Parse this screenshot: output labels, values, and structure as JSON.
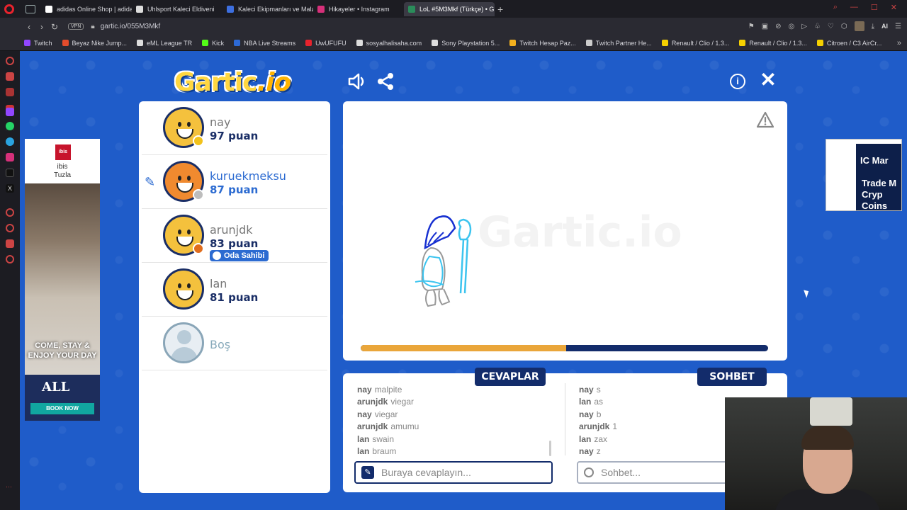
{
  "browser": {
    "tabs": [
      {
        "title": "adidas Online Shop | adidas",
        "color": "#ffffff"
      },
      {
        "title": "Uhlsport Kaleci Eldiveni",
        "color": "#dddddd"
      },
      {
        "title": "Kaleci Ekipmanları ve Malz",
        "color": "#3d6fe0"
      },
      {
        "title": "Hikayeler • Instagram",
        "color": "#d6307a"
      },
      {
        "title": "LoL #5M3Mkf (Türkçe) • G",
        "color": "#2a8c5a",
        "active": true
      }
    ],
    "new_tab": "+",
    "url": "gartic.io/055M3Mkf",
    "vpn_label": "VPN",
    "ai_label": "AI",
    "bookmarks": [
      {
        "label": "Twitch",
        "color": "#9146ff"
      },
      {
        "label": "Beyaz Nike Jump...",
        "color": "#e34c2c"
      },
      {
        "label": "eML League TR",
        "color": "#dddddd"
      },
      {
        "label": "Kick",
        "color": "#53fc18"
      },
      {
        "label": "NBA Live Streams",
        "color": "#2d6ad6"
      },
      {
        "label": "UwUFUFU",
        "color": "#e8232d"
      },
      {
        "label": "sosyalhalisaha.com",
        "color": "#dddddd"
      },
      {
        "label": "Sony Playstation 5...",
        "color": "#dddddd"
      },
      {
        "label": "Twitch Hesap Paz...",
        "color": "#f2b01e"
      },
      {
        "label": "Twitch Partner He...",
        "color": "#cccccc"
      },
      {
        "label": "Renault / Clio / 1.3...",
        "color": "#f5d000"
      },
      {
        "label": "Renault / Clio / 1.3...",
        "color": "#f5d000"
      },
      {
        "label": "Citroen / C3 AirCr...",
        "color": "#f5d000"
      }
    ]
  },
  "game": {
    "logo_main": "Gartic",
    "logo_suffix": ".io",
    "players": [
      {
        "name": "nay",
        "score": "97 puan",
        "avatar_color": "#f4c13d",
        "dot_color": "#f2c21b"
      },
      {
        "name": "kuruekmeksu",
        "score": "87 puan",
        "avatar_color": "#f08a2f",
        "dot_color": "#bdbdbd",
        "drawing": true
      },
      {
        "name": "arunjdk",
        "score": "83 puan",
        "avatar_color": "#f4c13d",
        "dot_color": "#e06d1d",
        "badge": "Oda Sahibi"
      },
      {
        "name": "lan",
        "score": "81 puan",
        "avatar_color": "#f4c13d"
      },
      {
        "name": "Boş",
        "empty": true
      }
    ],
    "watermark": "Gartic.io",
    "progress_fraction": 0.505,
    "answers_label": "CEVAPLAR",
    "chat_label": "SOHBET",
    "answers": [
      {
        "who": "nay",
        "text": "malpite"
      },
      {
        "who": "arunjdk",
        "text": "viegar"
      },
      {
        "who": "nay",
        "text": "viegar"
      },
      {
        "who": "arunjdk",
        "text": "amumu"
      },
      {
        "who": "lan",
        "text": "swain"
      },
      {
        "who": "lan",
        "text": "braum"
      }
    ],
    "chat": [
      {
        "who": "nay",
        "text": "s"
      },
      {
        "who": "lan",
        "text": "as"
      },
      {
        "who": "nay",
        "text": "b"
      },
      {
        "who": "arunjdk",
        "text": "1"
      },
      {
        "who": "lan",
        "text": "zax"
      },
      {
        "who": "nay",
        "text": "z"
      }
    ],
    "answer_placeholder": "Buraya cevaplayın...",
    "chat_placeholder": "Sohbet..."
  },
  "ads": {
    "left": {
      "brand": "ibis",
      "location": "ibis\nTuzla",
      "headline": "COME, STAY &\nENJOY YOUR DAY",
      "accor": "ALL",
      "cta": "BOOK NOW"
    },
    "right": {
      "brand": "IC Mar",
      "headline": "Trade M\nCryp\nCoins"
    }
  }
}
